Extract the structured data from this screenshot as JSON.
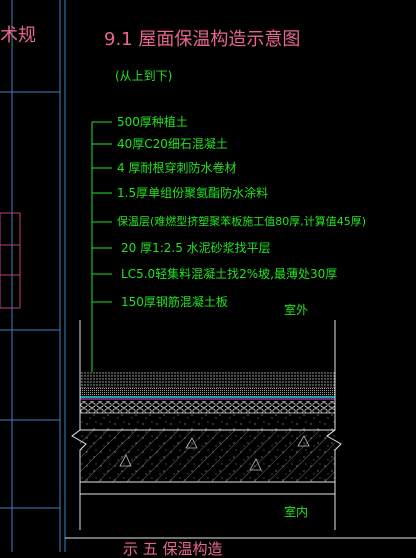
{
  "left_fragment": "术规",
  "title": "9.1  屋面保温构造示意图",
  "subtitle": "(从上到下)",
  "layers": [
    "500厚种植土",
    "40厚C20细石混凝土",
    "4  厚耐根穿刺防水卷材",
    "1.5厚单组份聚氨酯防水涂料",
    "保温层(难燃型挤塑聚苯板施工值80厚,计算值45厚)",
    "20 厚1:2.5   水泥砂浆找平层",
    "LC5.0轻集料混凝土找2%坡,最薄处30厚",
    "150厚钢筋混凝土板"
  ],
  "outdoor_label": "室外",
  "indoor_label": "室内",
  "bottom_fragment": "示 五   保温构造",
  "colors": {
    "background": "#000000",
    "title": "#e8668e",
    "annotation": "#1fe51f",
    "grid": "#3f7fbf",
    "frame": "#e6e6e6"
  }
}
